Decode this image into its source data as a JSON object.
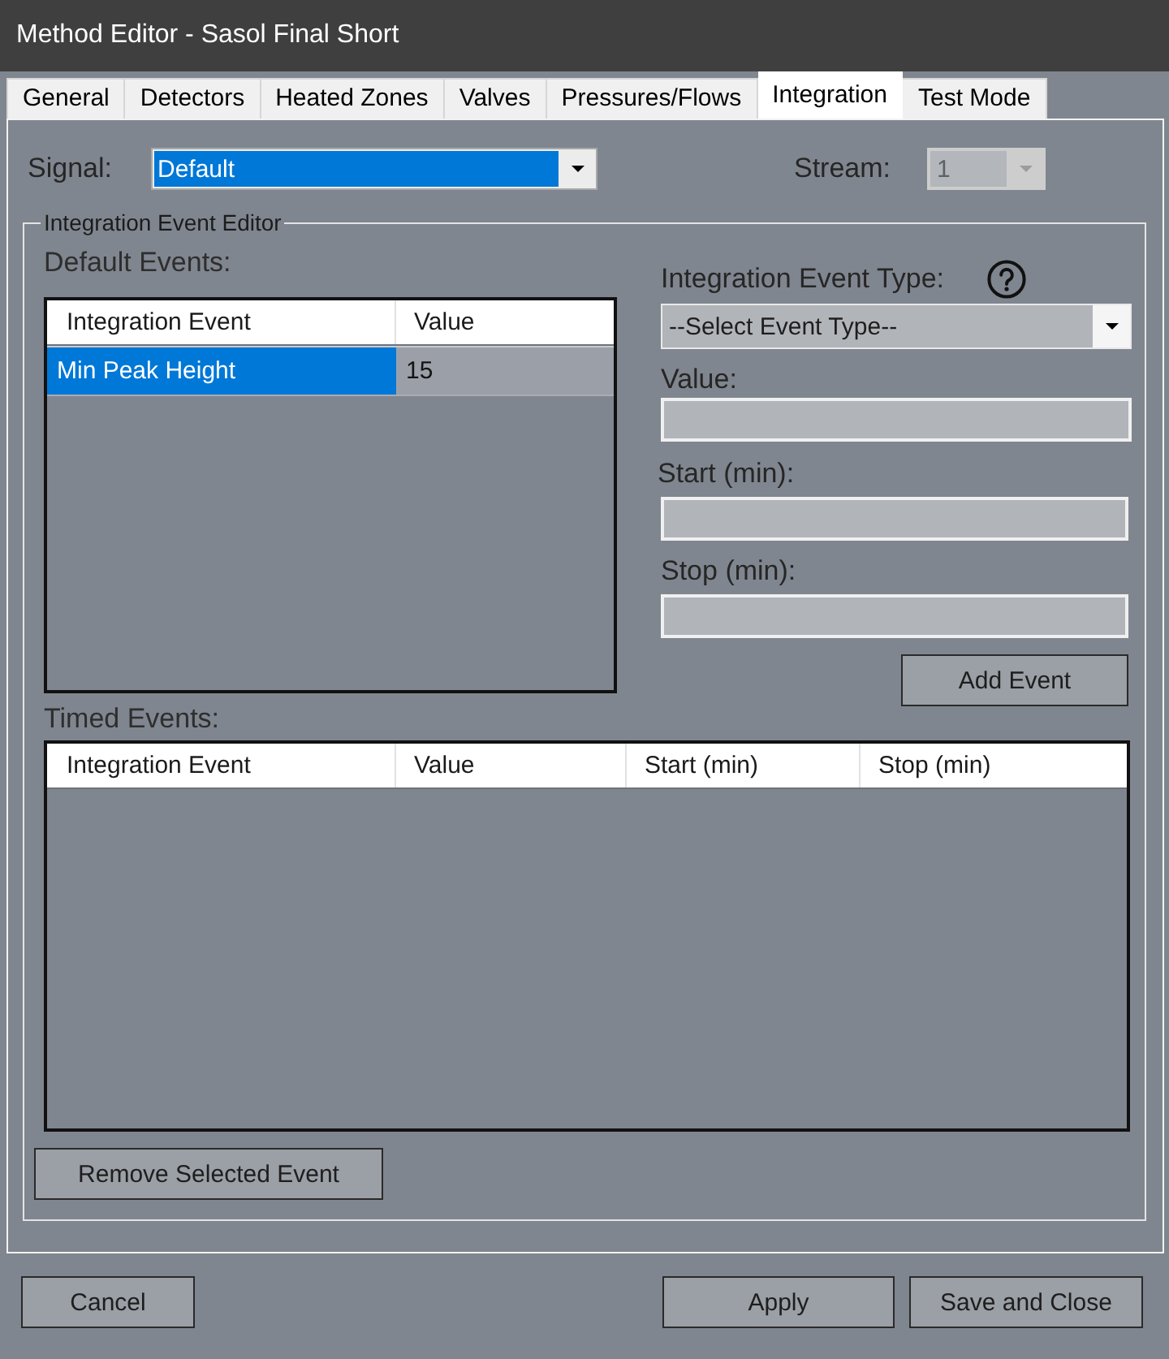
{
  "window": {
    "title": "Method Editor - Sasol Final Short"
  },
  "tabs": [
    {
      "label": "General",
      "selected": false
    },
    {
      "label": "Detectors",
      "selected": false
    },
    {
      "label": "Heated Zones",
      "selected": false
    },
    {
      "label": "Valves",
      "selected": false
    },
    {
      "label": "Pressures/Flows",
      "selected": false
    },
    {
      "label": "Integration",
      "selected": true
    },
    {
      "label": "Test Mode",
      "selected": false
    }
  ],
  "signal": {
    "label": "Signal:",
    "value": "Default",
    "focused": true
  },
  "stream": {
    "label": "Stream:",
    "value": "1",
    "disabled": true
  },
  "event_editor": {
    "title": "Integration Event Editor",
    "default_events": {
      "label": "Default Events:",
      "columns": [
        "Integration Event",
        "Value"
      ],
      "rows": [
        {
          "cells": [
            "Min Peak Height",
            "15"
          ],
          "selected": true
        }
      ]
    },
    "event_type": {
      "label": "Integration Event Type:",
      "value": "--Select Event Type--"
    },
    "fields": [
      {
        "label": "Value:"
      },
      {
        "label": "Start (min):"
      },
      {
        "label": "Stop (min):"
      }
    ],
    "add_button": "Add Event",
    "timed_events": {
      "label": "Timed Events:",
      "columns": [
        "Integration Event",
        "Value",
        "Start (min)",
        "Stop (min)"
      ]
    },
    "remove_button": "Remove Selected Event"
  },
  "buttons": [
    "Cancel",
    "Apply",
    "Save and Close"
  ]
}
